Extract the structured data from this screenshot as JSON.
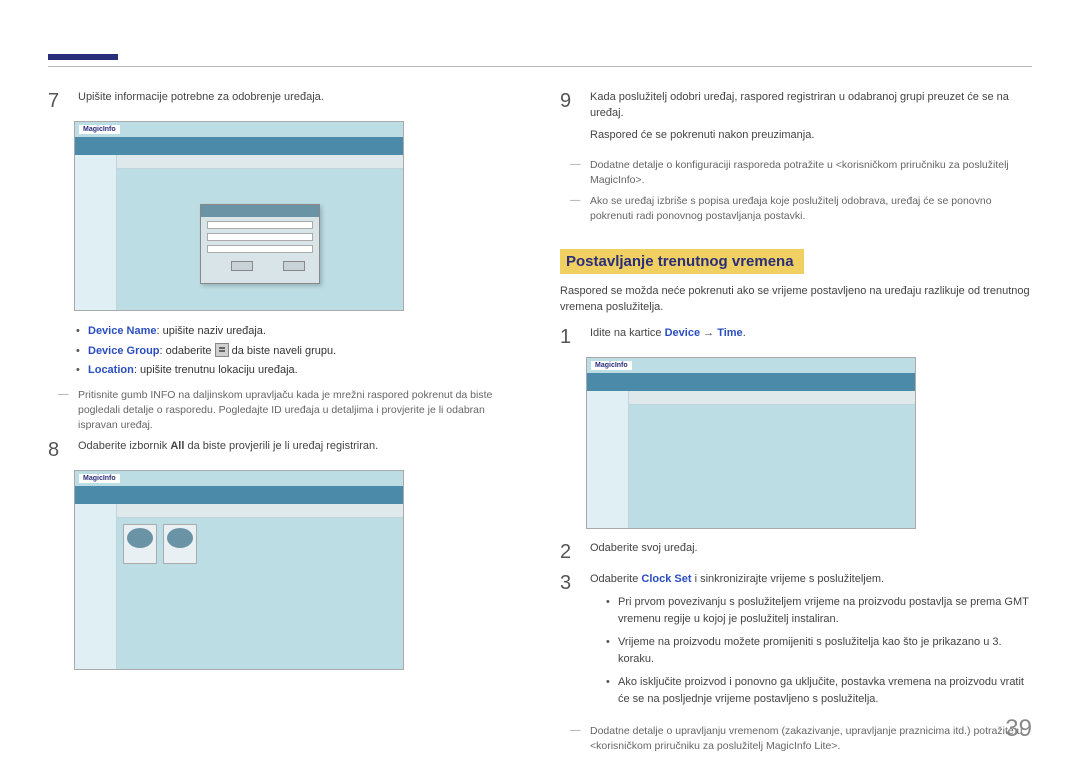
{
  "pageNumber": "39",
  "left": {
    "step7": {
      "num": "7",
      "text": "Upišite informacije potrebne za odobrenje uređaja.",
      "bullets": {
        "deviceName": {
          "label": "Device Name",
          "text": ": upišite naziv uređaja."
        },
        "deviceGroup": {
          "label": "Device Group",
          "before": ": odaberite ",
          "after": " da biste naveli grupu."
        },
        "location": {
          "label": "Location",
          "text": ": upišite trenutnu lokaciju uređaja."
        }
      },
      "note": "Pritisnite gumb INFO na daljinskom upravljaču kada je mrežni raspored pokrenut da biste pogledali detalje o rasporedu. Pogledajte ID uređaja u detaljima i provjerite je li odabran ispravan uređaj."
    },
    "step8": {
      "num": "8",
      "before": "Odaberite izbornik ",
      "bold": "All",
      "after": " da biste provjerili je li uređaj registriran."
    },
    "scLogo": "MagicInfo"
  },
  "right": {
    "step9": {
      "num": "9",
      "line1": "Kada poslužitelj odobri uređaj, raspored registriran u odabranoj grupi preuzet će se na uređaj.",
      "line2": "Raspored će se pokrenuti nakon preuzimanja."
    },
    "note1": "Dodatne detalje o konfiguraciji rasporeda potražite u <korisničkom priručniku za poslužitelj MagicInfo>.",
    "note2": "Ako se uređaj izbriše s popisa uređaja koje poslužitelj odobrava, uređaj će se ponovno pokrenuti radi ponovnog postavljanja postavki.",
    "heading": "Postavljanje trenutnog vremena",
    "intro": "Raspored se možda neće pokrenuti ako se vrijeme postavljeno na uređaju razlikuje od trenutnog vremena poslužitelja.",
    "step1": {
      "num": "1",
      "before": "Idite na kartice ",
      "link1": "Device",
      "arrow": " → ",
      "link2": "Time",
      "after": "."
    },
    "step2": {
      "num": "2",
      "text": "Odaberite svoj uređaj."
    },
    "step3": {
      "num": "3",
      "before": "Odaberite ",
      "link": "Clock Set",
      "after": " i sinkronizirajte vrijeme s poslužiteljem.",
      "bullets": [
        "Pri prvom povezivanju s poslužiteljem vrijeme na proizvodu postavlja se prema GMT vremenu regije u kojoj je poslužitelj instaliran.",
        "Vrijeme na proizvodu možete promijeniti s poslužitelja kao što je prikazano u 3. koraku.",
        "Ako isključite proizvod i ponovno ga uključite, postavka vremena na proizvodu vratit će se na posljednje vrijeme postavljeno s poslužitelja."
      ]
    },
    "note3": "Dodatne detalje o upravljanju vremenom (zakazivanje, upravljanje praznicima itd.) potražite u <korisničkom priručniku za poslužitelj MagicInfo Lite>."
  }
}
